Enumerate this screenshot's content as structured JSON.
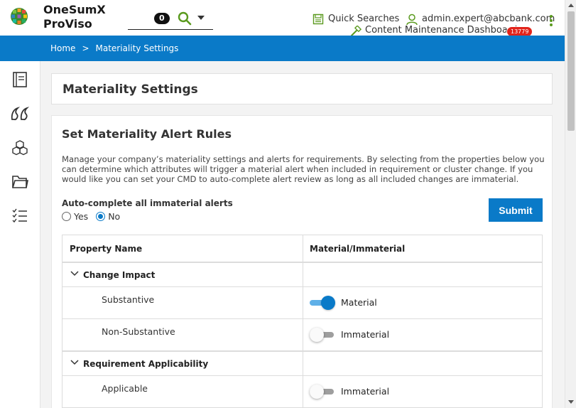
{
  "app": {
    "name_line1": "OneSumX",
    "name_line2": "ProViso"
  },
  "search": {
    "count": "0"
  },
  "header": {
    "quick_searches": "Quick Searches",
    "user": "admin.expert@abcbank.com",
    "cmd_dashboard": "Content Maintenance Dashboard",
    "cmd_count": "13779"
  },
  "breadcrumb": {
    "home": "Home",
    "separator": ">",
    "current": "Materiality Settings"
  },
  "page": {
    "title": "Materiality Settings"
  },
  "section": {
    "title": "Set Materiality Alert Rules",
    "description": "Manage your company’s materiality settings and alerts for requirements. By selecting from the properties below you can determine which attributes will trigger a material alert when included in requirement or cluster change. If you would like you can set your CMD to auto-complete alert review as long as all included changes are immaterial."
  },
  "autocomplete": {
    "label": "Auto-complete all immaterial alerts",
    "options": [
      "Yes",
      "No"
    ],
    "selected": "No"
  },
  "submit_label": "Submit",
  "table": {
    "headers": [
      "Property Name",
      "Material/Immaterial"
    ],
    "groups": [
      {
        "name": "Change Impact",
        "items": [
          {
            "name": "Substantive",
            "state": "Material",
            "on": true
          },
          {
            "name": "Non-Substantive",
            "state": "Immaterial",
            "on": false
          }
        ]
      },
      {
        "name": "Requirement Applicability",
        "items": [
          {
            "name": "Applicable",
            "state": "Immaterial",
            "on": false
          }
        ]
      }
    ]
  },
  "colors": {
    "brand_blue": "#0a7ac8",
    "badge_red": "#e2231a",
    "accent_green": "#5a9a1e"
  }
}
